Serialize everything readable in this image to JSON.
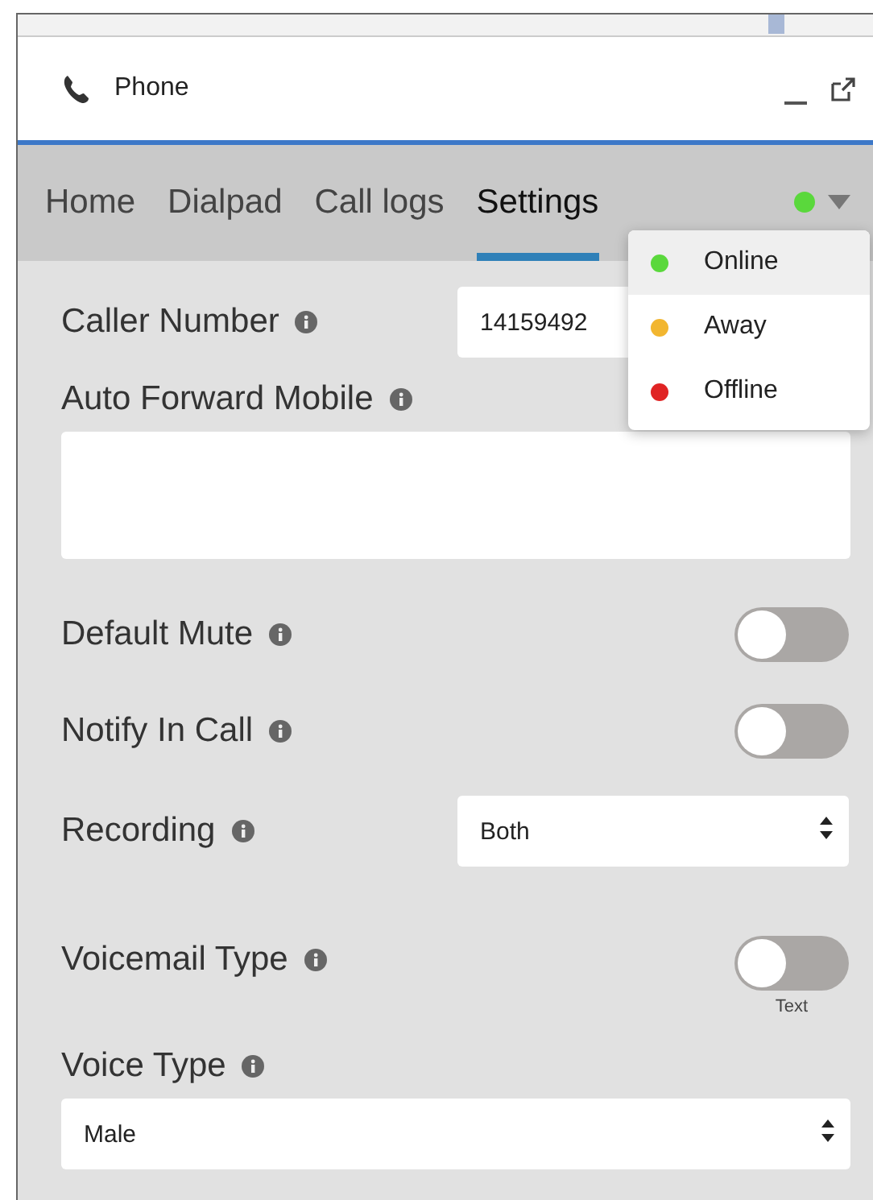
{
  "window": {
    "title": "Phone"
  },
  "tabs": [
    {
      "label": "Home",
      "selected": false
    },
    {
      "label": "Dialpad",
      "selected": false
    },
    {
      "label": "Call logs",
      "selected": false
    },
    {
      "label": "Settings",
      "selected": true
    }
  ],
  "status_menu": {
    "expanded": true,
    "items": [
      {
        "label": "Online",
        "color": "#5ad83c",
        "selected": true
      },
      {
        "label": "Away",
        "color": "#f2b630",
        "selected": false
      },
      {
        "label": "Offline",
        "color": "#e02424",
        "selected": false
      }
    ]
  },
  "settings": [
    {
      "kind": "text",
      "label": "Caller Number",
      "value": "14159492"
    },
    {
      "kind": "textarea",
      "label": "Auto Forward Mobile"
    },
    {
      "kind": "toggle",
      "label": "Default Mute",
      "on": false
    },
    {
      "kind": "toggle",
      "label": "Notify In Call",
      "on": false
    },
    {
      "kind": "select",
      "label": "Recording",
      "value": "Both"
    },
    {
      "kind": "toggle",
      "label": "Voicemail Type",
      "on": false,
      "caption": "Text"
    },
    {
      "kind": "select_wide",
      "label": "Voice Type",
      "value": "Male"
    }
  ]
}
